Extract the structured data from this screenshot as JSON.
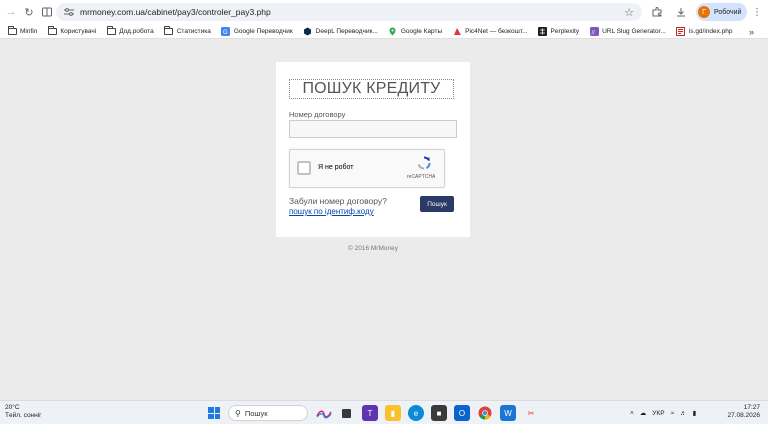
{
  "browser": {
    "url": "mrmoney.com.ua/cabinet/pay3/controler_pay3.php",
    "profile_initial": "Г",
    "profile_name": "Робочий"
  },
  "bookmarks": [
    {
      "label": "Minfin",
      "icon": "folder-icon"
    },
    {
      "label": "Користувачі",
      "icon": "folder-icon"
    },
    {
      "label": "Дод.робота",
      "icon": "folder-icon"
    },
    {
      "label": "Статистика",
      "icon": "folder-icon"
    },
    {
      "label": "Google Переводчик",
      "icon": "google-translate-icon"
    },
    {
      "label": "DeepL Переводчик...",
      "icon": "deepl-icon"
    },
    {
      "label": "Google Карты",
      "icon": "google-maps-icon"
    },
    {
      "label": "Pic4Net — безкошт...",
      "icon": "pic4net-icon"
    },
    {
      "label": "Perplexity",
      "icon": "perplexity-icon"
    },
    {
      "label": "URL Slug Generator...",
      "icon": "url-slug-icon"
    },
    {
      "label": "is.gd/index.php",
      "icon": "isgd-icon"
    }
  ],
  "form": {
    "title": "ПОШУК КРЕДИТУ",
    "contract_label": "Номер договору",
    "contract_value": "",
    "captcha_label": "Я не робот",
    "captcha_brand": "reCAPTCHA",
    "forgot_text": "Забули номер договору?",
    "forgot_link": "пошук по ідентиф.коду",
    "search_button": "Пошук"
  },
  "footer": "© 2016 MrMoney",
  "taskbar": {
    "temp": "20°C",
    "weather": "Tейл. сонніг",
    "search_placeholder": "Пошук",
    "lang": "УКР",
    "time": "17:27",
    "date": "27.08.2026"
  },
  "colors": {
    "button": "#2b3a67",
    "link": "#0645ad",
    "page_bg": "#ebebeb"
  }
}
